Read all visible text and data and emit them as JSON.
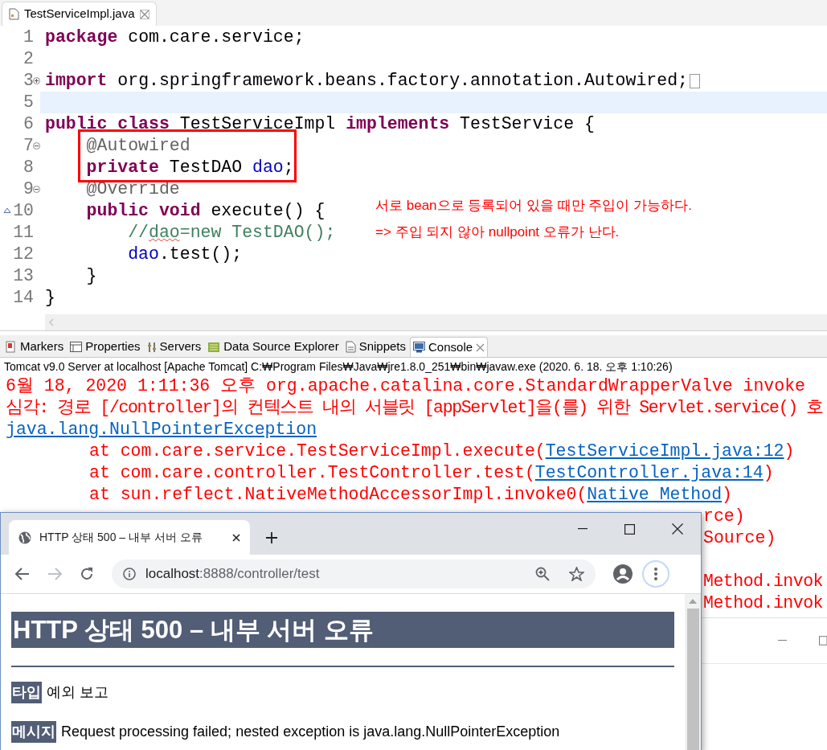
{
  "editor": {
    "tab": {
      "title": "TestServiceImpl.java",
      "selected": true
    },
    "lines": [
      {
        "number": "1",
        "tokens": [
          {
            "kind": "keyword",
            "text": "package"
          },
          {
            "kind": "plain",
            "text": " com.care.service;"
          }
        ]
      },
      {
        "number": "2"
      },
      {
        "number": "3",
        "collapsible": true,
        "collapsed": true,
        "tokens": [
          {
            "kind": "keyword",
            "text": "import"
          },
          {
            "kind": "plain",
            "text": " org.springframework.beans.factory.annotation.Autowired;"
          }
        ]
      },
      {
        "number": "5",
        "current": true
      },
      {
        "number": "6",
        "tokens": [
          {
            "kind": "keyword",
            "text": "public class"
          },
          {
            "kind": "plain",
            "text": " TestServiceImpl "
          },
          {
            "kind": "keyword",
            "text": "implements"
          },
          {
            "kind": "plain",
            "text": " TestService {"
          }
        ]
      },
      {
        "number": "7",
        "collapsible": true,
        "collapsed": false,
        "boxed": true,
        "tokens": [
          {
            "kind": "annotation",
            "text": "    @Autowired"
          }
        ]
      },
      {
        "number": "8",
        "boxed": true,
        "tokens": [
          {
            "kind": "keyword",
            "text": "    private"
          },
          {
            "kind": "plain",
            "text": " TestDAO "
          },
          {
            "kind": "field",
            "text": "dao"
          },
          {
            "kind": "plain",
            "text": ";"
          }
        ]
      },
      {
        "number": "9",
        "collapsible": true,
        "collapsed": false,
        "tokens": [
          {
            "kind": "annotation",
            "text": "    @Override"
          }
        ]
      },
      {
        "number": "10",
        "overrides": true,
        "tokens": [
          {
            "kind": "keyword",
            "text": "    public void"
          },
          {
            "kind": "plain",
            "text": " execute() {"
          }
        ]
      },
      {
        "number": "11",
        "tokens": [
          {
            "kind": "comment",
            "text": "        //"
          },
          {
            "kind": "misspelled",
            "text": "dao"
          },
          {
            "kind": "comment",
            "text": "=new TestDAO();"
          }
        ]
      },
      {
        "number": "12",
        "tokens": [
          {
            "kind": "field",
            "text": "        dao"
          },
          {
            "kind": "plain",
            "text": ".test();"
          }
        ]
      },
      {
        "number": "13",
        "tokens": [
          {
            "kind": "plain",
            "text": "    }"
          }
        ]
      },
      {
        "number": "14",
        "tokens": [
          {
            "kind": "plain",
            "text": "}"
          }
        ]
      }
    ],
    "notes": [
      "서로 bean으로 등록되어 있을 때만 주입이 가능하다.",
      "=> 주입 되지 않아 nullpoint 오류가 난다."
    ]
  },
  "console": {
    "tabs": [
      {
        "label": "Markers",
        "selected": false
      },
      {
        "label": "Properties",
        "selected": false
      },
      {
        "label": "Servers",
        "selected": false
      },
      {
        "label": "Data Source Explorer",
        "selected": false
      },
      {
        "label": "Snippets",
        "selected": false
      },
      {
        "label": "Console",
        "selected": true
      }
    ],
    "process": "Tomcat v9.0 Server at localhost [Apache Tomcat] C:₩Program Files₩Java₩jre1.8.0_251₩bin₩javaw.exe  (2020. 6. 18. 오후 1:10:26)",
    "lines": [
      {
        "kind": "message",
        "tokens": [
          {
            "kind": "error",
            "text": "6월 18, 2020 1:11:36 오후 org.apache.catalina.core.StandardWrapperValve invoke"
          }
        ]
      },
      {
        "kind": "message",
        "tokens": [
          {
            "kind": "error",
            "text": "심각: 경로 [/controller]의 컨텍스트 내의 서블릿 [appServlet]을(를) 위한 Servlet.service() 호"
          }
        ]
      },
      {
        "kind": "message",
        "tokens": [
          {
            "kind": "link",
            "text": "java.lang.NullPointerException"
          }
        ]
      },
      {
        "kind": "frame",
        "tokens": [
          {
            "kind": "error",
            "text": "at com.care.service.TestServiceImpl.execute("
          },
          {
            "kind": "link",
            "text": "TestServiceImpl.java:12"
          },
          {
            "kind": "error",
            "text": ")"
          }
        ]
      },
      {
        "kind": "frame",
        "tokens": [
          {
            "kind": "error",
            "text": "at com.care.controller.TestController.test("
          },
          {
            "kind": "link",
            "text": "TestController.java:14"
          },
          {
            "kind": "error",
            "text": ")"
          }
        ]
      },
      {
        "kind": "frame",
        "tokens": [
          {
            "kind": "error",
            "text": "at sun.reflect.NativeMethodAccessorImpl.invoke0("
          },
          {
            "kind": "link",
            "text": "Native Method"
          },
          {
            "kind": "error",
            "text": ")"
          }
        ]
      }
    ],
    "partial_line_groups": [
      [
        "rce)",
        "Source)"
      ],
      [
        "Method.invok",
        "Method.invok"
      ]
    ]
  },
  "browser": {
    "tab_title": "HTTP 상태 500 – 내부 서버 오류",
    "url_host": "localhost",
    "url_rest": ":8888/controller/test",
    "heading": "HTTP 상태 500 – 내부 서버 오류",
    "fields": [
      {
        "label": "타입",
        "value": "예외 보고"
      },
      {
        "label": "메시지",
        "value": "Request processing failed; nested exception is java.lang.NullPointerException"
      }
    ]
  }
}
